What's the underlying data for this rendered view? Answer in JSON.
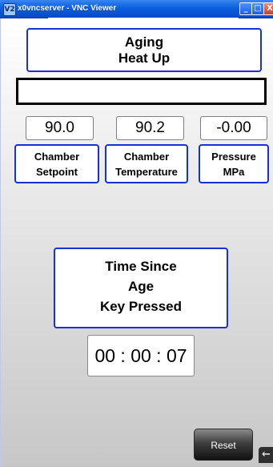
{
  "window": {
    "app_icon_text": "V2",
    "title": "x0vncserver - VNC Viewer",
    "buttons": {
      "minimize": "_",
      "maximize": "□",
      "close": "X"
    }
  },
  "status": {
    "mode_line1": "Aging",
    "mode_line2": "Heat Up",
    "message": ""
  },
  "readings": [
    {
      "value": "90.0",
      "label_line1": "Chamber",
      "label_line2": "Setpoint"
    },
    {
      "value": "90.2",
      "label_line1": "Chamber",
      "label_line2": "Temperature"
    },
    {
      "value": "-0.00",
      "label_line1": "Pressure",
      "label_line2": "MPa"
    }
  ],
  "timer": {
    "label_line1": "Time Since",
    "label_line2": "Age",
    "label_line3": "Key Pressed",
    "value": "00 : 00 : 07"
  },
  "controls": {
    "reset_label": "Reset",
    "back_icon": "←"
  },
  "icons": {
    "app": "vnc-app-icon",
    "back": "back-arrow-icon"
  },
  "colors": {
    "panel_border": "#1730d8",
    "titlebar": "#0a5fe0",
    "reset_button": "#3e3e3e"
  }
}
